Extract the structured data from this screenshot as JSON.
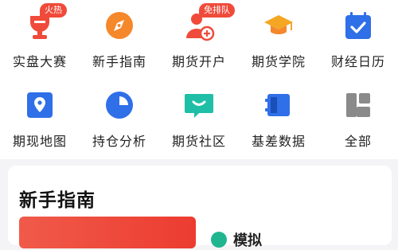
{
  "grid": {
    "items": [
      {
        "label": "实盘大赛",
        "icon": "trophy-icon",
        "badge": "火热"
      },
      {
        "label": "新手指南",
        "icon": "compass-icon"
      },
      {
        "label": "期货开户",
        "icon": "add-user-icon",
        "badge": "免排队"
      },
      {
        "label": "期货学院",
        "icon": "graduation-cap-icon"
      },
      {
        "label": "财经日历",
        "icon": "calendar-check-icon"
      },
      {
        "label": "期现地图",
        "icon": "map-pin-icon"
      },
      {
        "label": "持仓分析",
        "icon": "pie-chart-icon"
      },
      {
        "label": "期货社区",
        "icon": "chat-bubble-icon"
      },
      {
        "label": "基差数据",
        "icon": "data-panel-icon"
      },
      {
        "label": "全部",
        "icon": "all-apps-icon"
      }
    ]
  },
  "card": {
    "title": "新手指南",
    "sub_item_label": "模拟"
  },
  "colors": {
    "orange": "#f5882b",
    "blue": "#1f6fe5",
    "teal": "#1fbfa7",
    "gray": "#8a8a8a",
    "red_banner": "#ec3c30"
  }
}
